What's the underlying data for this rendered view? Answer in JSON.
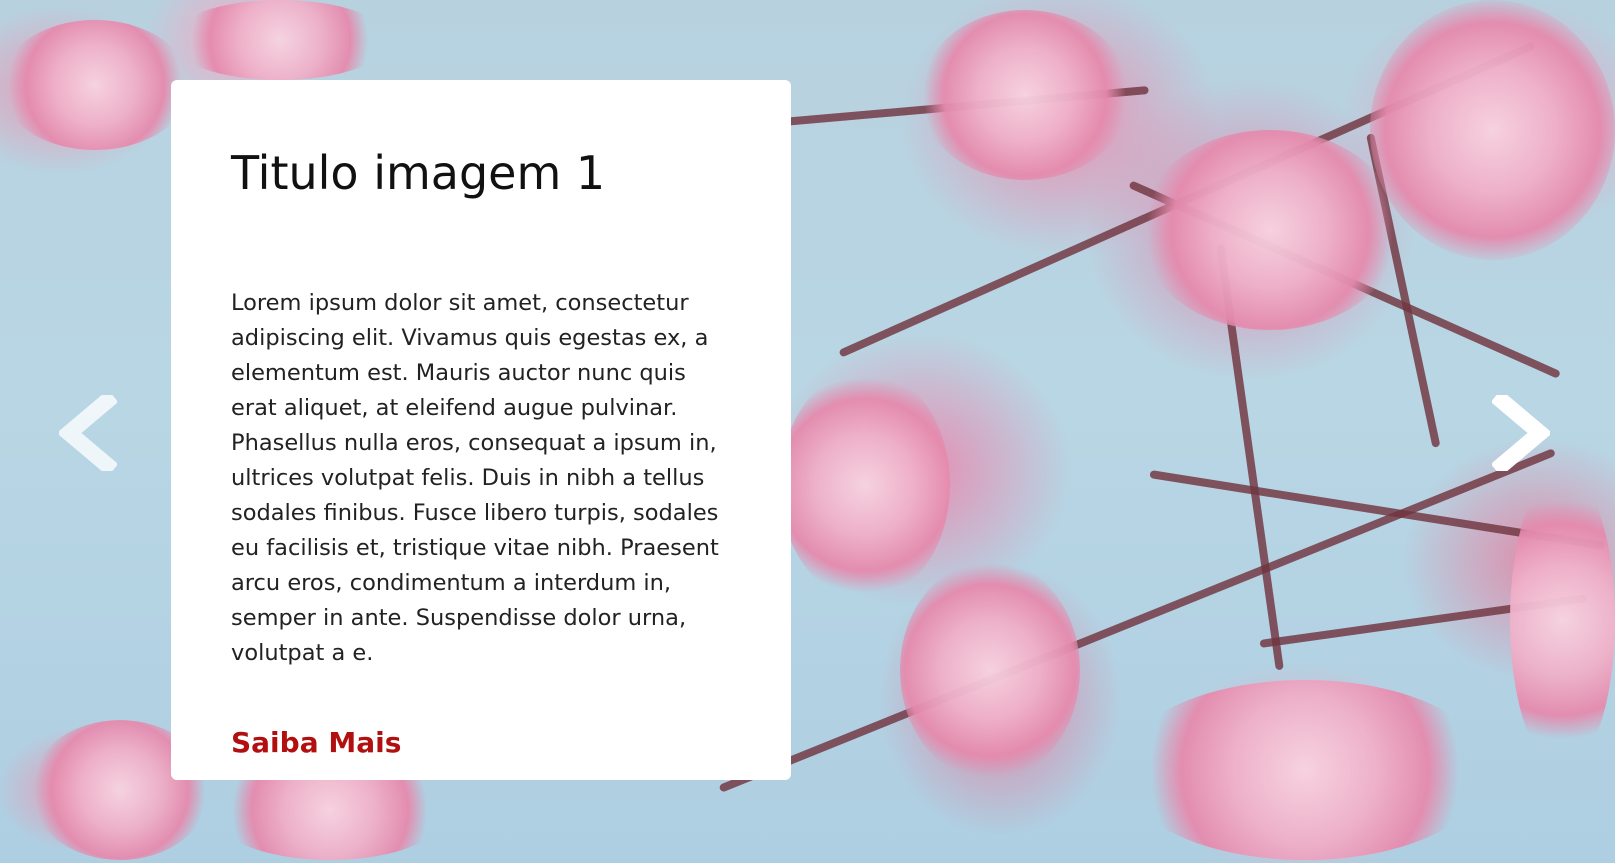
{
  "slide": {
    "title": "Titulo imagem 1",
    "body": "Lorem ipsum dolor sit amet, consectetur adipiscing elit. Vivamus quis egestas ex, a elementum est. Mauris auctor nunc quis erat aliquet, at eleifend augue pulvinar. Phasellus nulla eros, consequat a ipsum in, ultrices volutpat felis. Duis in nibh a tellus sodales finibus. Fusce libero turpis, sodales eu facilisis et, tristique vitae nibh. Praesent arcu eros, condimentum a interdum in, semper in ante. Suspendisse dolor urna, volutpat a e.",
    "cta_label": "Saiba Mais"
  },
  "navigation": {
    "previous_icon": "chevron-left-icon",
    "next_icon": "chevron-right-icon"
  },
  "background": {
    "subject": "cherry-blossom-branches"
  },
  "colors": {
    "card_background": "#ffffff",
    "title_text": "#111111",
    "body_text": "#222222",
    "cta": "#b21010",
    "arrow": "#ffffff"
  }
}
